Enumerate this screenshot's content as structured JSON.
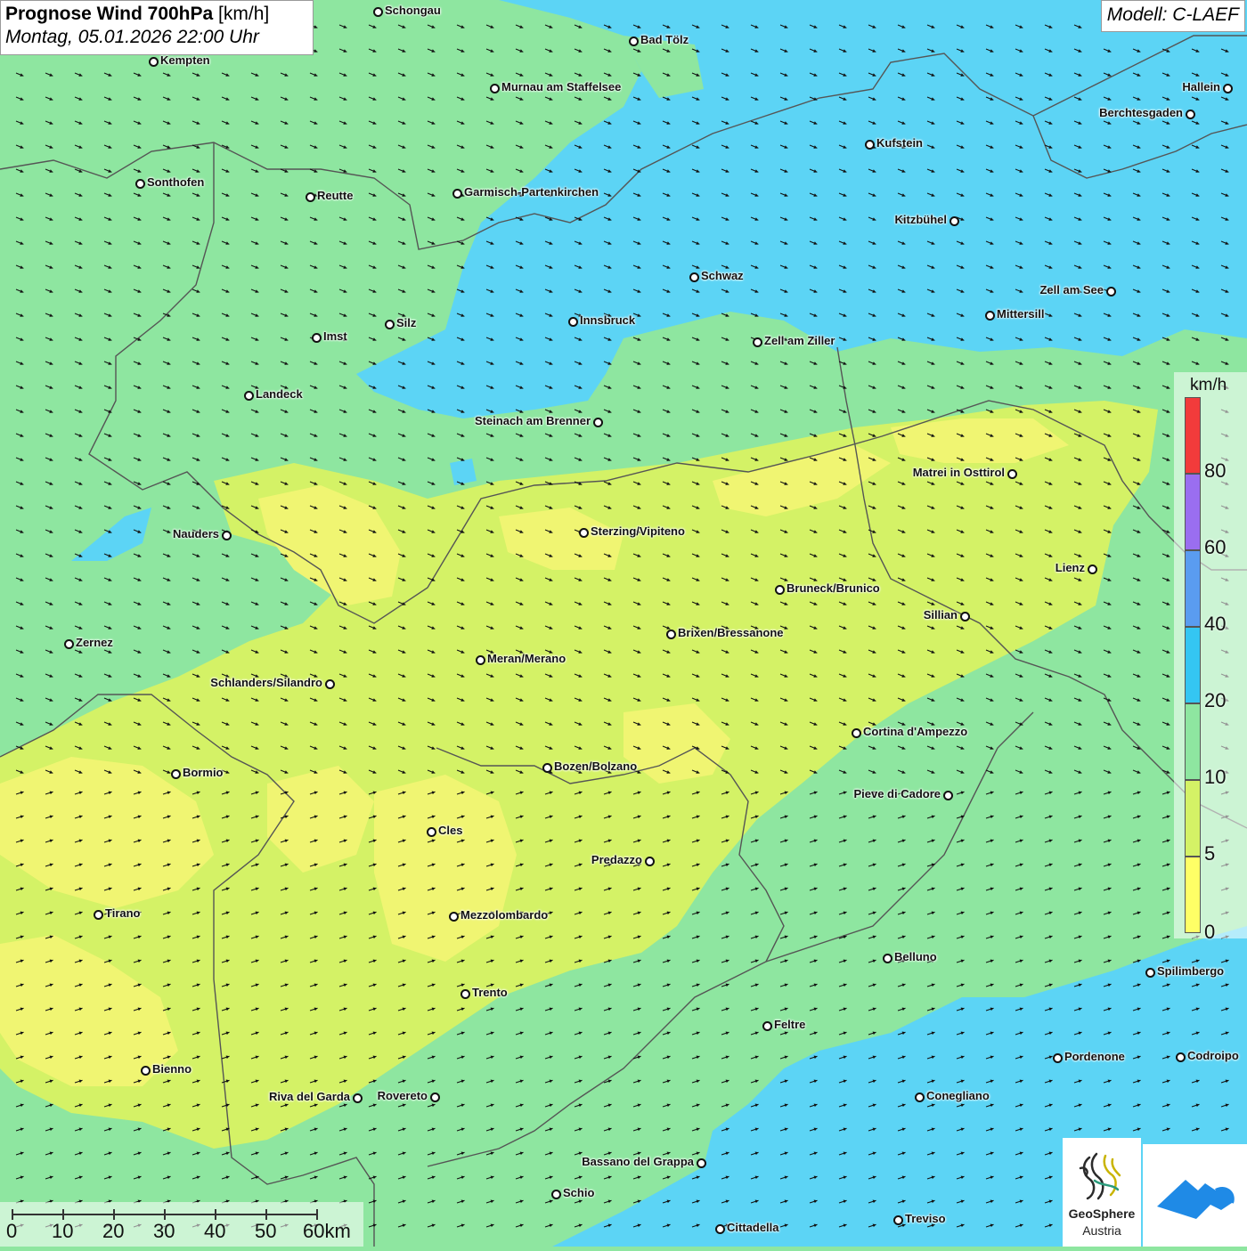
{
  "header": {
    "title_bold": "Prognose Wind 700hPa",
    "title_unit": " [km/h]",
    "datetime": "Montag, 05.01.2026 22:00 Uhr",
    "model": "Modell: C-LAEF"
  },
  "legend": {
    "unit": "km/h",
    "labels": [
      "80",
      "60",
      "40",
      "20",
      "10",
      "5",
      "0"
    ],
    "colors": [
      "#f23b3b",
      "#9a6ef0",
      "#5a9cf0",
      "#34c6f2",
      "#8ee6a0",
      "#d4f266",
      "#ffff66"
    ]
  },
  "scale_bar": {
    "labels": [
      "0",
      "10",
      "20",
      "30",
      "40",
      "50",
      "60km"
    ]
  },
  "logos": {
    "geosphere_name": "GeoSphere",
    "geosphere_sub": "Austria"
  },
  "cities": [
    {
      "name": "Schongau"
    },
    {
      "name": "Bad Tölz"
    },
    {
      "name": "Kempten"
    },
    {
      "name": "Murnau am Staffelsee"
    },
    {
      "name": "Hallein"
    },
    {
      "name": "Berchtesgaden"
    },
    {
      "name": "Kufstein"
    },
    {
      "name": "Sonthofen"
    },
    {
      "name": "Reutte"
    },
    {
      "name": "Garmisch-Partenkirchen"
    },
    {
      "name": "Kitzbühel"
    },
    {
      "name": "Schwaz"
    },
    {
      "name": "Zell am See"
    },
    {
      "name": "Mittersill"
    },
    {
      "name": "Innsbruck"
    },
    {
      "name": "Silz"
    },
    {
      "name": "Imst"
    },
    {
      "name": "Zell am Ziller"
    },
    {
      "name": "Landeck"
    },
    {
      "name": "Steinach am Brenner"
    },
    {
      "name": "Matrei in Osttirol"
    },
    {
      "name": "Nauders"
    },
    {
      "name": "Sterzing/Vipiteno"
    },
    {
      "name": "Lienz"
    },
    {
      "name": "Bruneck/Brunico"
    },
    {
      "name": "Sillian"
    },
    {
      "name": "Zernez"
    },
    {
      "name": "Brixen/Bressanone"
    },
    {
      "name": "Meran/Merano"
    },
    {
      "name": "Schlanders/Silandro"
    },
    {
      "name": "Cortina d'Ampezzo"
    },
    {
      "name": "Bozen/Bolzano"
    },
    {
      "name": "Bormio"
    },
    {
      "name": "Pieve di Cadore"
    },
    {
      "name": "Cles"
    },
    {
      "name": "Predazzo"
    },
    {
      "name": "Tirano"
    },
    {
      "name": "Mezzolombardo"
    },
    {
      "name": "Belluno"
    },
    {
      "name": "Spilimbergo"
    },
    {
      "name": "Trento"
    },
    {
      "name": "Feltre"
    },
    {
      "name": "Pordenone"
    },
    {
      "name": "Codroipo"
    },
    {
      "name": "Bienno"
    },
    {
      "name": "Riva del Garda"
    },
    {
      "name": "Rovereto"
    },
    {
      "name": "Conegliano"
    },
    {
      "name": "Bassano del Grappa"
    },
    {
      "name": "Schio"
    },
    {
      "name": "Treviso"
    },
    {
      "name": "Cittadella"
    }
  ]
}
